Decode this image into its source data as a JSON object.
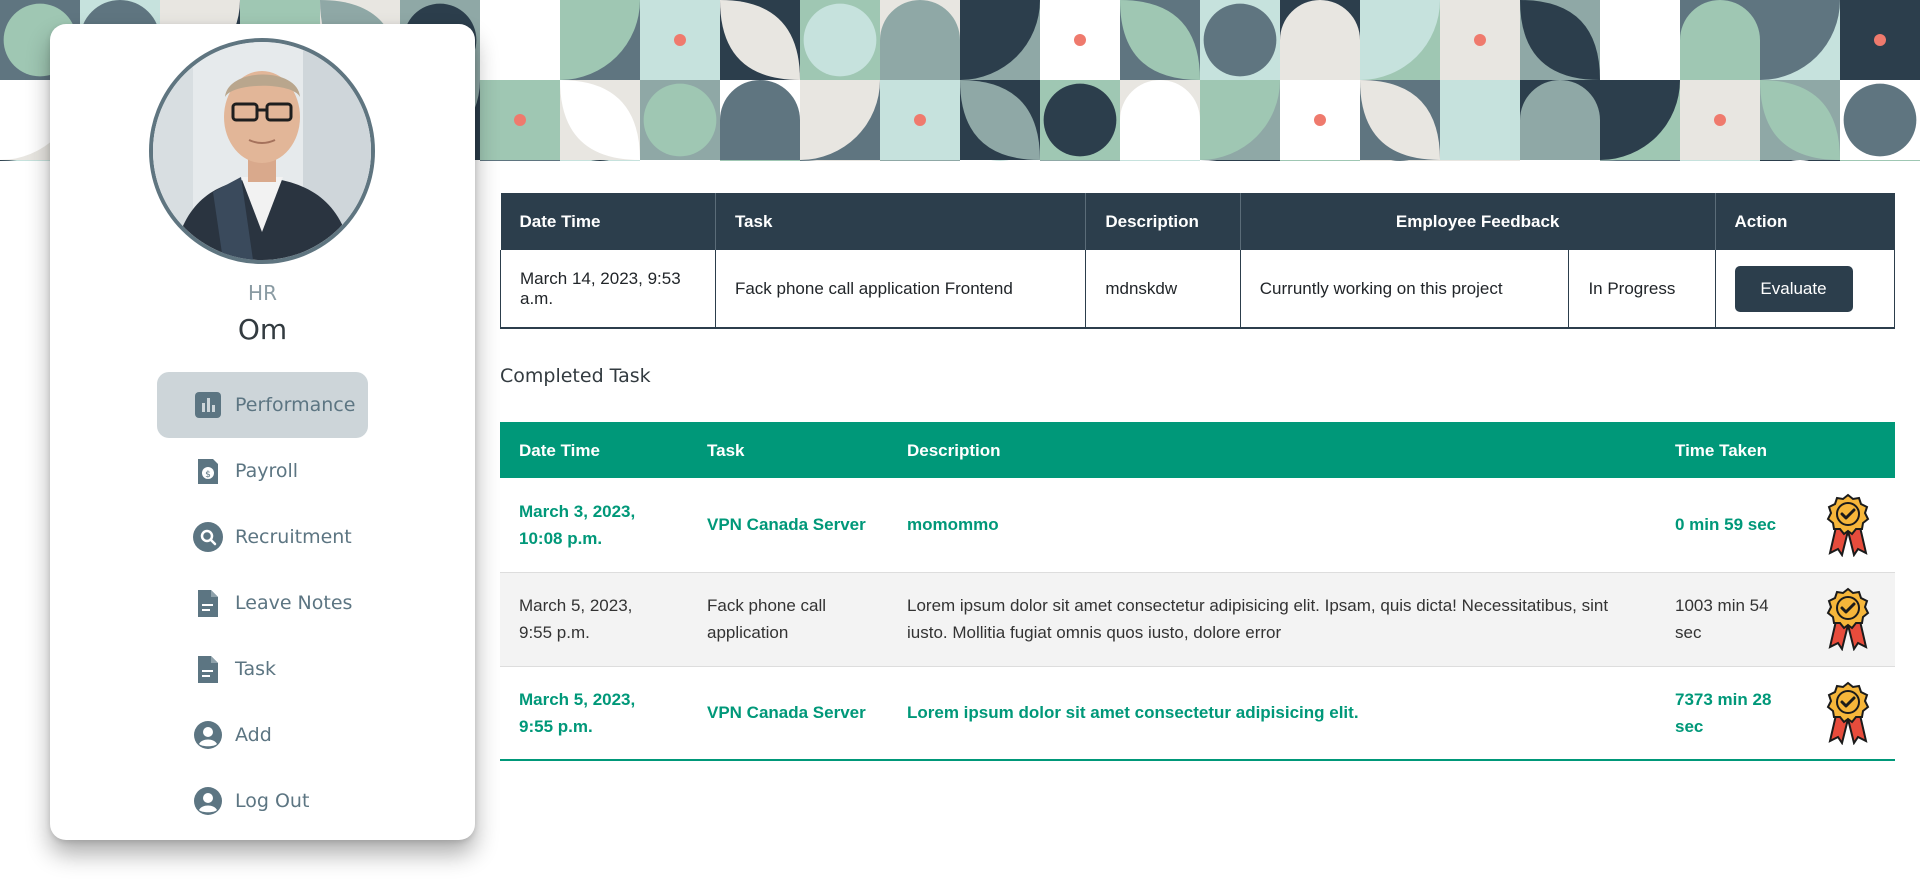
{
  "sidebar": {
    "role": "HR",
    "name": "Om",
    "nav": [
      {
        "label": "Performance",
        "icon": "bar-chart-icon",
        "active": true
      },
      {
        "label": "Payroll",
        "icon": "payroll-document-icon",
        "active": false
      },
      {
        "label": "Recruitment",
        "icon": "search-icon",
        "active": false
      },
      {
        "label": "Leave Notes",
        "icon": "document-icon",
        "active": false
      },
      {
        "label": "Task",
        "icon": "document-icon",
        "active": false
      },
      {
        "label": "Add",
        "icon": "user-circle-icon",
        "active": false
      },
      {
        "label": "Log Out",
        "icon": "user-circle-icon",
        "active": false
      }
    ]
  },
  "current_table": {
    "headers": [
      "Date Time",
      "Task",
      "Description",
      "Employee Feedback",
      "Action"
    ],
    "row": {
      "date_time": "March 14, 2023, 9:53 a.m.",
      "task": "Fack phone call application Frontend",
      "description": "mdnskdw",
      "feedback": "Curruntly working on this project",
      "status": "In Progress",
      "action_label": "Evaluate"
    }
  },
  "completed": {
    "title": "Completed Task",
    "headers": [
      "Date Time",
      "Task",
      "Description",
      "Time Taken",
      ""
    ],
    "rows": [
      {
        "date_time": "March 3, 2023, 10:08 p.m.",
        "task": "VPN Canada Server",
        "description": "momommo",
        "time_taken": "0 min 59 sec"
      },
      {
        "date_time": "March 5, 2023, 9:55 p.m.",
        "task": "Fack phone call application",
        "description": "Lorem ipsum dolor sit amet consectetur adipisicing elit. Ipsam, quis dicta! Necessitatibus, sint iusto. Mollitia fugiat omnis quos iusto, dolore error",
        "time_taken": "1003 min 54 sec"
      },
      {
        "date_time": "March 5, 2023, 9:55 p.m.",
        "task": "VPN Canada Server",
        "description": "Lorem ipsum dolor sit amet consectetur adipisicing elit.",
        "time_taken": "7373 min 28 sec"
      }
    ]
  },
  "colors": {
    "navy": "#2c3e4c",
    "green": "#009879",
    "sidebar_text": "#5c7582",
    "active_bg": "#cdd5d9"
  }
}
